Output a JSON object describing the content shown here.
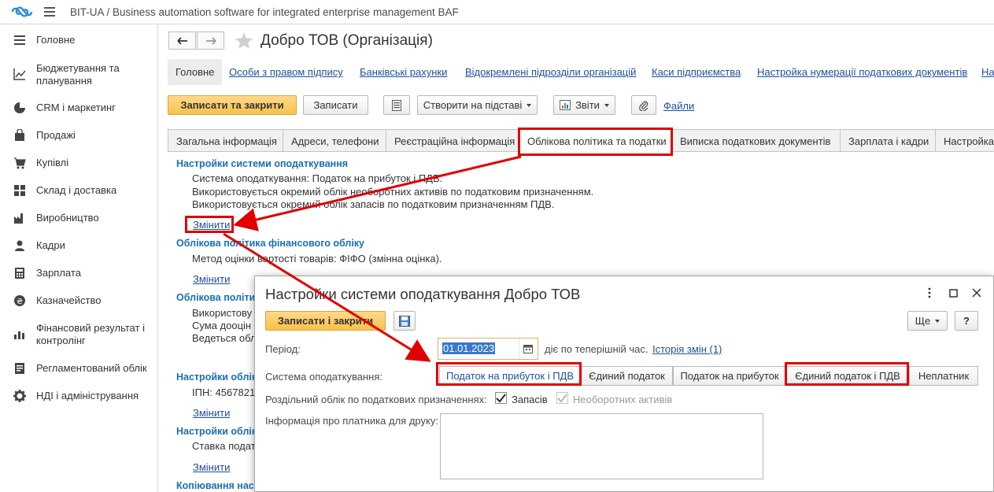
{
  "app": {
    "title": "BIT-UA / Business automation software for integrated enterprise management BAF"
  },
  "sidebar": {
    "items": [
      {
        "label": "Головне",
        "icon": "menu-icon"
      },
      {
        "label": "Бюджетування та планування",
        "icon": "chart-icon"
      },
      {
        "label": "CRM і маркетинг",
        "icon": "pie-icon"
      },
      {
        "label": "Продажі",
        "icon": "bag-icon"
      },
      {
        "label": "Купівлі",
        "icon": "cart-icon"
      },
      {
        "label": "Склад і доставка",
        "icon": "grid-icon"
      },
      {
        "label": "Виробництво",
        "icon": "factory-icon"
      },
      {
        "label": "Кадри",
        "icon": "person-icon"
      },
      {
        "label": "Зарплата",
        "icon": "calculator-icon"
      },
      {
        "label": "Казначейство",
        "icon": "coin-icon"
      },
      {
        "label": "Фінансовий результат і контролінг",
        "icon": "bar-chart-icon"
      },
      {
        "label": "Регламентований облік",
        "icon": "report-icon"
      },
      {
        "label": "НДІ і адміністрування",
        "icon": "gear-icon"
      }
    ]
  },
  "document": {
    "title": "Добро ТОВ (Організація)"
  },
  "panel_tabs": [
    {
      "label": "Головне"
    },
    {
      "label": "Особи з правом підпису"
    },
    {
      "label": "Банківські рахунки"
    },
    {
      "label": "Відокремлені підрозділи організацій"
    },
    {
      "label": "Каси підприємства"
    },
    {
      "label": "Настройка нумерації податкових документів"
    },
    {
      "label": "На"
    }
  ],
  "toolbar": {
    "save_close": "Записати та закрити",
    "save": "Записати",
    "create_based": "Створити на підставі",
    "reports": "Звіти",
    "files": "Файли"
  },
  "form_tabs": [
    {
      "label": "Загальна інформація"
    },
    {
      "label": "Адреси, телефони"
    },
    {
      "label": "Реєстраційна інформація"
    },
    {
      "label": "Облікова політика та податки"
    },
    {
      "label": "Виписка податкових документів"
    },
    {
      "label": "Зарплата і кадри"
    },
    {
      "label": "Настройка"
    }
  ],
  "content": {
    "sec1_title": "Настройки системи оподаткування",
    "sec1_line1": "Система оподаткування: Податок на прибуток і ПДВ.",
    "sec1_line2": "Використовується окремий облік необоротних активів по податковим призначенням.",
    "sec1_line3": "Використовується окремий облік запасів по податковим призначенням ПДВ.",
    "change_link": "Змінити",
    "sec2_title": "Облікова політика фінансового обліку",
    "sec2_line1": "Метод оцінки вартості товарів: ФІФО (змінна оцінка).",
    "sec3_title": "Облікова політи",
    "sec3_line1": "Використову",
    "sec3_line2": "Сума дооцін",
    "sec3_line3": "Ведеться обл",
    "sec4_title": "Настройки облік",
    "sec4_line1": "ІПН: 4567821",
    "sec5_title": "Настройки облік",
    "sec5_line1": "Ставка подат",
    "sec6_title": "Копіювання наст"
  },
  "dialog": {
    "title": "Настройки системи оподаткування Добро ТОВ",
    "save_close": "Записати і закрити",
    "more": "Ще",
    "help": "?",
    "period_label": "Період:",
    "period_value": "01.01.2023",
    "period_note": "діє по теперішній час.",
    "history_link": "Історія змін (1)",
    "system_label": "Система оподаткування:",
    "options": [
      {
        "label": "Податок на прибуток і ПДВ",
        "selected": true
      },
      {
        "label": "Єдиний податок",
        "selected": false
      },
      {
        "label": "Податок на прибуток",
        "selected": false
      },
      {
        "label": "Єдиний податок і ПДВ",
        "selected": false
      },
      {
        "label": "Неплатник",
        "selected": false
      }
    ],
    "separate_label": "Роздільний облік по податкових призначеннях:",
    "check_stock": "Запасів",
    "check_stock_checked": true,
    "check_assets": "Необоротних активів",
    "check_assets_checked": true,
    "print_info_label": "Інформація про платника для друку:",
    "print_info_value": ""
  },
  "colors": {
    "accent_yellow": "#f7c14c",
    "link_blue": "#1f4f9c",
    "section_blue": "#1a6fb4",
    "annotation_red": "#e00000"
  }
}
